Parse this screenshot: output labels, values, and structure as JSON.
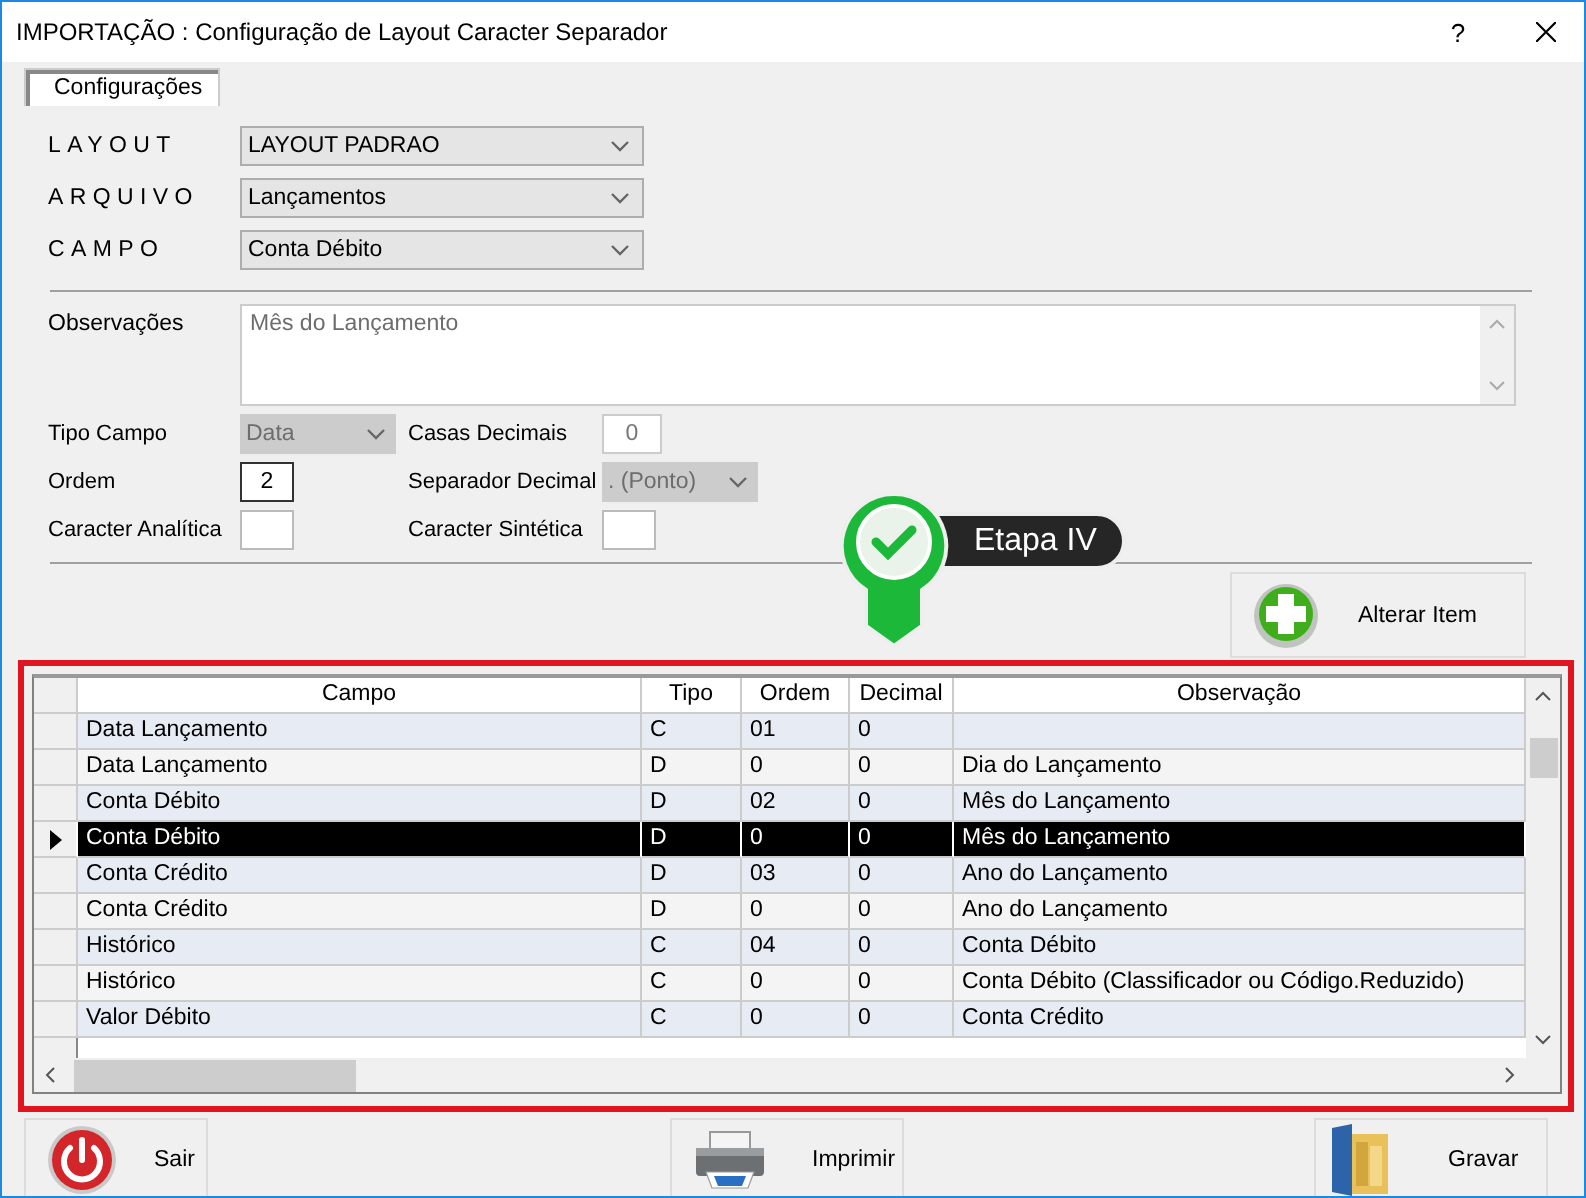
{
  "window": {
    "title": "IMPORTAÇÃO : Configuração de Layout Caracter Separador",
    "help": "?"
  },
  "tabs": [
    {
      "label": "Configurações",
      "selected": true
    }
  ],
  "selectors": [
    {
      "label": "LAYOUT",
      "value": "LAYOUT PADRAO"
    },
    {
      "label": "ARQUIVO",
      "value": "Lançamentos"
    },
    {
      "label": "CAMPO",
      "value": "Conta Débito"
    }
  ],
  "observacoes": {
    "label": "Observações",
    "value": "Mês do Lançamento"
  },
  "fields": [
    {
      "kind": "combo",
      "label": "Tipo Campo",
      "value": "Data",
      "disabled": true,
      "focused": false
    },
    {
      "kind": "text",
      "label": "Casas Decimais",
      "value": "0",
      "disabled": true,
      "focused": false
    },
    {
      "kind": "text",
      "label": "Ordem",
      "value": "2",
      "disabled": false,
      "focused": true
    },
    {
      "kind": "combo",
      "label": "Separador Decimal",
      "value": ". (Ponto)",
      "disabled": true,
      "focused": false
    },
    {
      "kind": "text",
      "label": "Caracter Analítica",
      "disabled": false,
      "focused": false
    },
    {
      "kind": "text",
      "label": "Caracter Sintética",
      "disabled": false,
      "focused": false
    }
  ],
  "callout": {
    "text": "Etapa IV"
  },
  "action_button": {
    "label": "Alterar Item"
  },
  "grid": {
    "columns": [
      "Campo",
      "Tipo",
      "Ordem",
      "Decimal",
      "Observação"
    ],
    "rows": [
      {
        "cells": [
          "Data Lançamento",
          "C",
          "01",
          "0"
        ],
        "selected": false
      },
      {
        "cells": [
          "Data Lançamento",
          "D",
          "0",
          "0",
          "Dia do Lançamento"
        ],
        "selected": false
      },
      {
        "cells": [
          "Conta Débito",
          "D",
          "02",
          "0",
          "Mês do Lançamento"
        ],
        "selected": false
      },
      {
        "cells": [
          "Conta Débito",
          "D",
          "0",
          "0",
          "Mês do Lançamento"
        ],
        "selected": true
      },
      {
        "cells": [
          "Conta Crédito",
          "D",
          "03",
          "0",
          "Ano do Lançamento"
        ],
        "selected": false
      },
      {
        "cells": [
          "Conta Crédito",
          "D",
          "0",
          "0",
          "Ano do Lançamento"
        ],
        "selected": false
      },
      {
        "cells": [
          "Histórico",
          "C",
          "04",
          "0",
          "Conta Débito"
        ],
        "selected": false
      },
      {
        "cells": [
          "Histórico",
          "C",
          "0",
          "0",
          "Conta Débito (Classificador ou Código.Reduzido)"
        ],
        "selected": false
      },
      {
        "cells": [
          "Valor Débito",
          "C",
          "0",
          "0",
          "Conta Crédito"
        ],
        "selected": false
      }
    ]
  },
  "footer_buttons": [
    {
      "kind": "exit",
      "label": "Sair"
    },
    {
      "kind": "print",
      "label": "Imprimir"
    },
    {
      "kind": "save",
      "label": "Gravar"
    }
  ]
}
